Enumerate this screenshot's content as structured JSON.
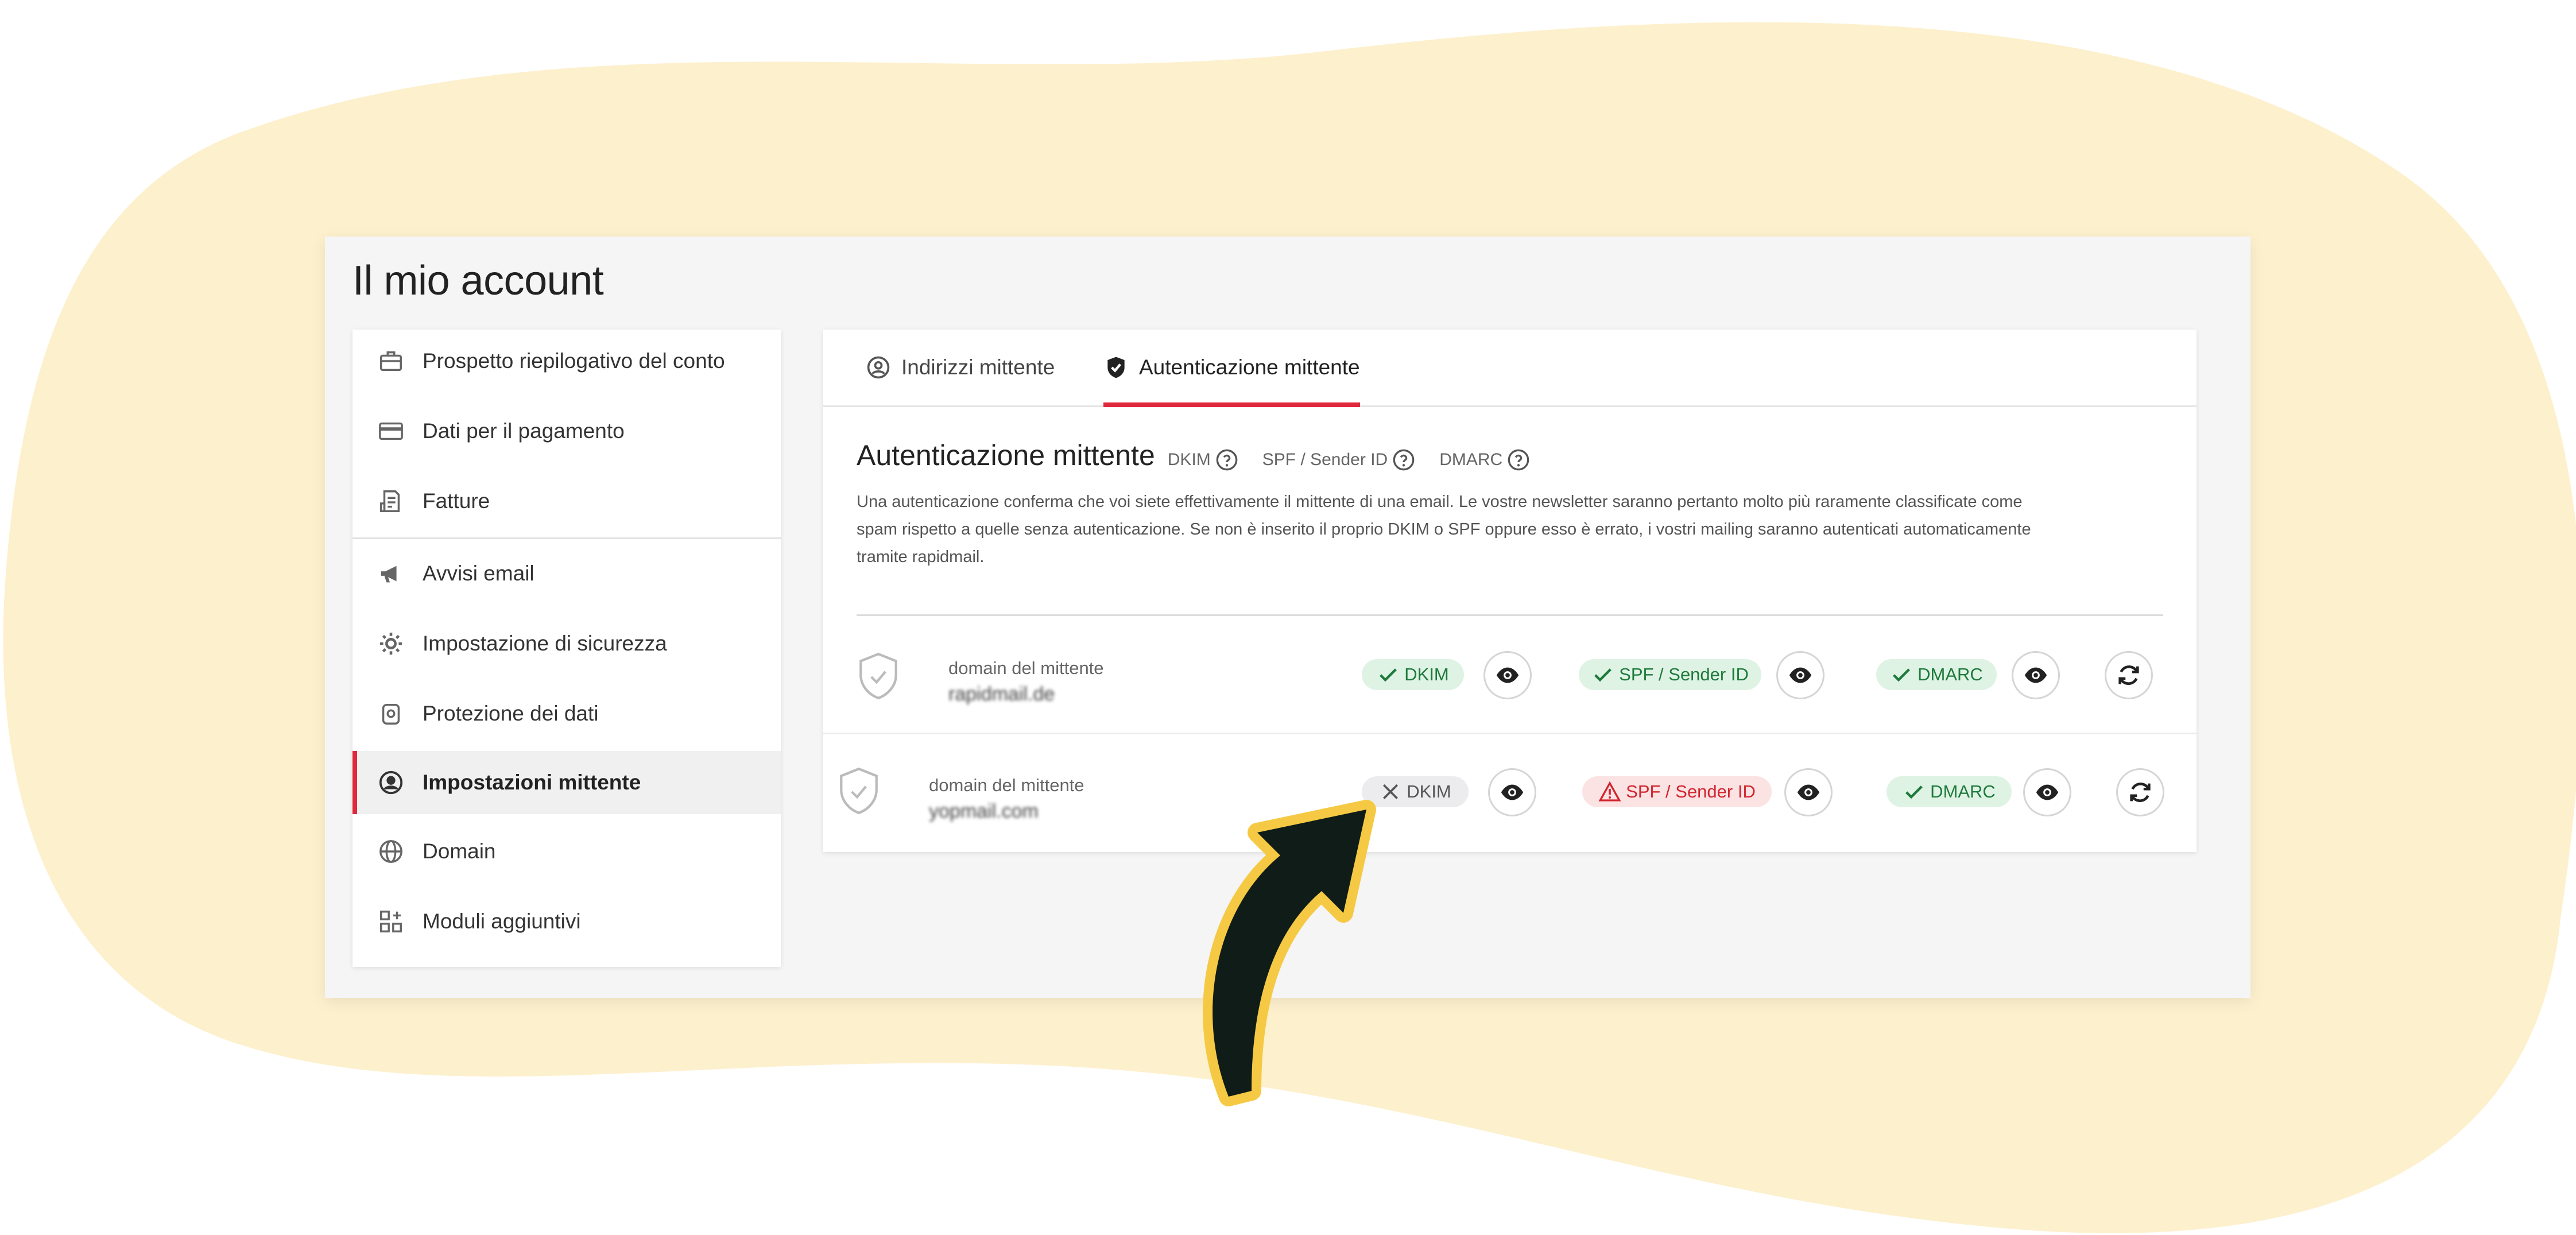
{
  "colors": {
    "background_blob": "#fdf0cd",
    "accent": "#e0283d",
    "ok": "#1e7a3b",
    "error": "#d2252f",
    "arrow_fill": "#f6c944",
    "arrow_body": "#0f1c17"
  },
  "page_title": "Il mio account",
  "sidebar": {
    "items": [
      {
        "label": "Prospetto riepilogativo del conto",
        "icon": "briefcase-icon",
        "active": false
      },
      {
        "label": "Dati per il pagamento",
        "icon": "credit-card-icon",
        "active": false
      },
      {
        "label": "Fatture",
        "icon": "invoice-icon",
        "active": false
      },
      {
        "label": "Avvisi email",
        "icon": "megaphone-icon",
        "active": false
      },
      {
        "label": "Impostazione di sicurezza",
        "icon": "gear-icon",
        "active": false
      },
      {
        "label": "Protezione dei dati",
        "icon": "lock-icon",
        "active": false
      },
      {
        "label": "Impostazioni mittente",
        "icon": "user-circle-icon",
        "active": true
      },
      {
        "label": "Domain",
        "icon": "globe-icon",
        "active": false
      },
      {
        "label": "Moduli aggiuntivi",
        "icon": "modules-icon",
        "active": false
      }
    ]
  },
  "tabs": [
    {
      "label": "Indirizzi mittente",
      "icon": "user-circle-icon",
      "active": false
    },
    {
      "label": "Autenticazione mittente",
      "icon": "shield-check-icon",
      "active": true
    }
  ],
  "section": {
    "title": "Autenticazione mittente",
    "help_links": [
      "DKIM",
      "SPF / Sender ID",
      "DMARC"
    ],
    "description_lines": [
      "Una autenticazione conferma che voi siete effettivamente il mittente di una email. Le vostre newsletter saranno pertanto molto più raramente classificate come",
      "spam rispetto a quelle senza autenticazione. Se non è inserito il proprio DKIM o SPF oppure esso è errato, i vostri mailing saranno autenticati automaticamente",
      "tramite rapidmail."
    ]
  },
  "domains": [
    {
      "label": "domain del mittente",
      "value": "rapidmail.de",
      "dkim": {
        "label": "DKIM",
        "status": "ok"
      },
      "spf": {
        "label": "SPF / Sender ID",
        "status": "ok"
      },
      "dmarc": {
        "label": "DMARC",
        "status": "ok"
      }
    },
    {
      "label": "domain del mittente",
      "value": "yopmail.com",
      "dkim": {
        "label": "DKIM",
        "status": "missing"
      },
      "spf": {
        "label": "SPF / Sender ID",
        "status": "error"
      },
      "dmarc": {
        "label": "DMARC",
        "status": "ok"
      }
    }
  ]
}
